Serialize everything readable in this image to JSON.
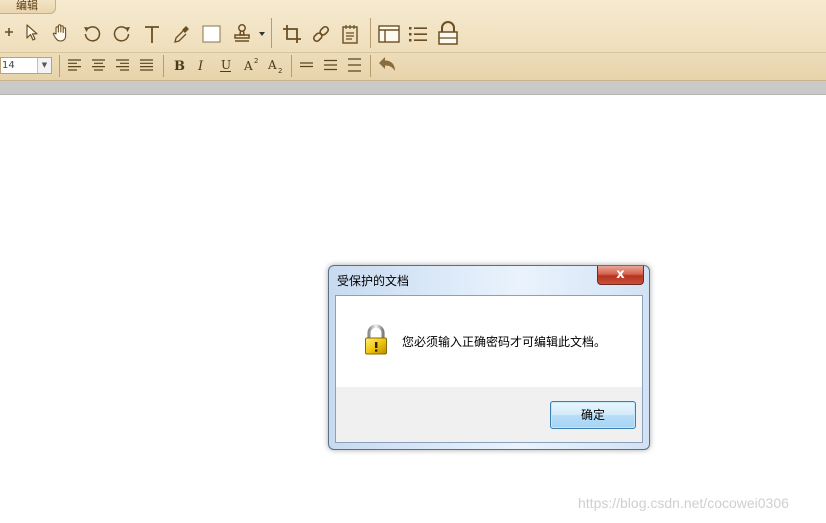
{
  "ribbon": {
    "tab_label": "编辑",
    "font_size_value": "14",
    "icon_color": "#6b4f22"
  },
  "toolbar_row1": [
    "add-icon",
    "pointer-icon",
    "hand-icon",
    "rotate-left-icon",
    "rotate-right-icon",
    "text-tool-icon",
    "eyedropper-icon",
    "rectangle-icon",
    "stamp-icon",
    "crop-icon",
    "link-icon",
    "note-icon",
    "layout-icon",
    "list-icon",
    "lock-icon"
  ],
  "toolbar_row2": [
    "align-left-icon",
    "align-center-icon",
    "align-right-icon",
    "justify-icon",
    "bold-icon",
    "italic-icon",
    "underline-icon",
    "superscript-icon",
    "subscript-icon",
    "line-spacing-1-icon",
    "line-spacing-2-icon",
    "line-spacing-3-icon",
    "undo-icon"
  ],
  "dialog": {
    "title": "受保护的文档",
    "close_label": "x",
    "message": "您必须输入正确密码才可编辑此文档。",
    "ok_label": "确定"
  },
  "watermark": "https://blog.csdn.net/cocowei0306"
}
